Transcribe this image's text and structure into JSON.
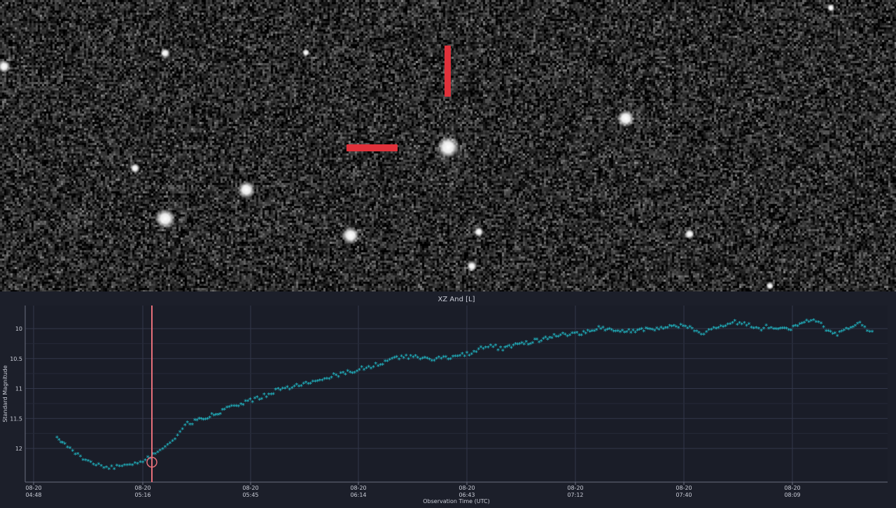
{
  "image": {
    "marker_color": "#e0313a",
    "stars": [
      {
        "x": 640,
        "y": 210,
        "r": 9
      },
      {
        "x": 894,
        "y": 169,
        "r": 7
      },
      {
        "x": 236,
        "y": 312,
        "r": 8
      },
      {
        "x": 352,
        "y": 271,
        "r": 7
      },
      {
        "x": 501,
        "y": 336,
        "r": 7
      },
      {
        "x": 193,
        "y": 240,
        "r": 4
      },
      {
        "x": 684,
        "y": 331,
        "r": 4
      },
      {
        "x": 985,
        "y": 334,
        "r": 4
      },
      {
        "x": 674,
        "y": 380,
        "r": 4
      },
      {
        "x": 236,
        "y": 76,
        "r": 4
      },
      {
        "x": 6,
        "y": 95,
        "r": 5
      },
      {
        "x": 1187,
        "y": 11,
        "r": 3
      },
      {
        "x": 437,
        "y": 75,
        "r": 3
      },
      {
        "x": 1100,
        "y": 408,
        "r": 3
      }
    ]
  },
  "chart_data": {
    "type": "scatter",
    "title": "XZ And [L]",
    "xlabel": "Observation Time (UTC)",
    "ylabel": "Standard Magnitude",
    "y_inverted": true,
    "ylim": [
      12.55,
      9.6
    ],
    "xlim_minutes": [
      0,
      1320
    ],
    "x_ticks": [
      {
        "top": "08-20",
        "bottom": "04:48",
        "min": 0
      },
      {
        "top": "08-20",
        "bottom": "05:16",
        "min": 28
      },
      {
        "top": "08-20",
        "bottom": "05:45",
        "min": 57
      },
      {
        "top": "08-20",
        "bottom": "06:14",
        "min": 86
      },
      {
        "top": "08-20",
        "bottom": "06:43",
        "min": 115
      },
      {
        "top": "08-20",
        "bottom": "07:12",
        "min": 144
      },
      {
        "top": "08-20",
        "bottom": "07:40",
        "min": 172
      },
      {
        "top": "08-20",
        "bottom": "08:09",
        "min": 201
      }
    ],
    "y_ticks": [
      "10",
      "10.5",
      "11",
      "11.5",
      "12"
    ],
    "y_tick_values": [
      10,
      10.5,
      11,
      11.5,
      12
    ],
    "grid": true,
    "series_color": "#22c7d4",
    "cursor_color": "#e8707a",
    "cursor_time": "05:18",
    "cursor_mag": 12.23,
    "series": [
      {
        "x_minutes": [
          6,
          7,
          8,
          10,
          12,
          14,
          16,
          18,
          20,
          22,
          24,
          26,
          28,
          30,
          32,
          34,
          36,
          38,
          40,
          42,
          46,
          50,
          55,
          60,
          65,
          70,
          75,
          80,
          85,
          90,
          95,
          100,
          105,
          110,
          115,
          120,
          122,
          124,
          128,
          132,
          136,
          140,
          145,
          150,
          155,
          160,
          165,
          170,
          173,
          176,
          178,
          180,
          185,
          190,
          192,
          194,
          196,
          200,
          203,
          206,
          208,
          210,
          213,
          216,
          219,
          221
        ],
        "values": [
          11.82,
          11.88,
          11.95,
          12.05,
          12.15,
          12.22,
          12.28,
          12.32,
          12.33,
          12.3,
          12.27,
          12.25,
          12.22,
          12.15,
          12.08,
          12.0,
          11.88,
          11.72,
          11.6,
          11.56,
          11.47,
          11.37,
          11.26,
          11.15,
          11.02,
          10.96,
          10.87,
          10.79,
          10.71,
          10.63,
          10.53,
          10.47,
          10.53,
          10.5,
          10.44,
          10.32,
          10.3,
          10.35,
          10.29,
          10.24,
          10.17,
          10.12,
          10.1,
          10.0,
          10.06,
          10.04,
          10.02,
          9.98,
          9.97,
          10.1,
          10.07,
          9.99,
          9.9,
          9.97,
          10.03,
          9.96,
          10.0,
          10.02,
          9.95,
          9.87,
          9.88,
          10.03,
          10.1,
          10.02,
          9.92,
          10.03
        ]
      }
    ]
  }
}
